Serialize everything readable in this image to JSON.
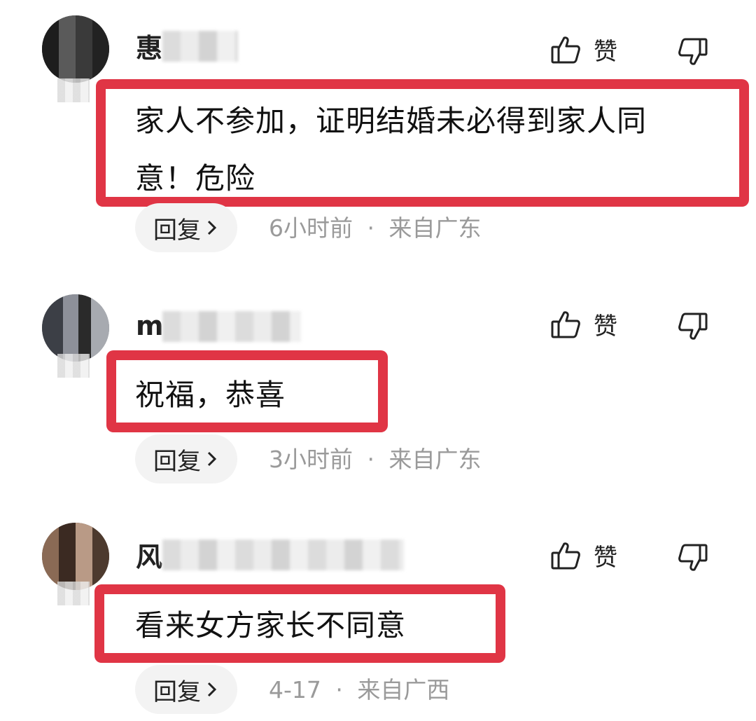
{
  "comments": [
    {
      "username": "惠",
      "text_lines": [
        "家人不参加，证明结婚未必得到家人同",
        "意！危险"
      ],
      "like_label": "赞",
      "reply_label": "回复",
      "time": "6小时前",
      "separator": "·",
      "location": "来自广东"
    },
    {
      "username": "m",
      "text_lines": [
        "祝福，恭喜"
      ],
      "like_label": "赞",
      "reply_label": "回复",
      "time": "3小时前",
      "separator": "·",
      "location": "来自广东"
    },
    {
      "username": "风",
      "text_lines": [
        "看来女方家长不同意"
      ],
      "like_label": "赞",
      "reply_label": "回复",
      "time": "4-17",
      "separator": "·",
      "location": "来自广西"
    }
  ],
  "colors": {
    "highlight_border": "#e03545",
    "meta_text": "#9a9a9a",
    "reply_bg": "#f3f3f3"
  },
  "icons": [
    "thumbs-up-icon",
    "thumbs-down-icon",
    "chevron-right-icon"
  ]
}
